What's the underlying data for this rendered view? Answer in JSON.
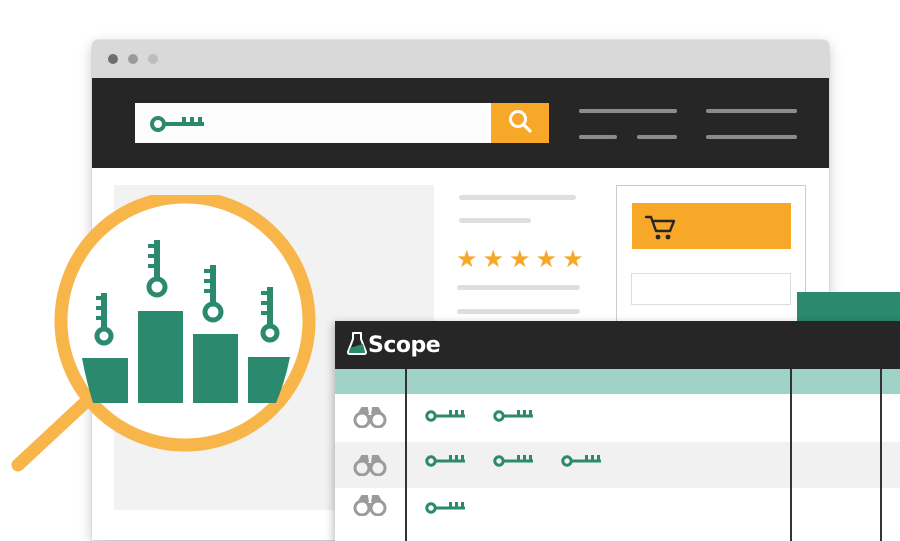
{
  "app": {
    "name": "Scope",
    "logo_icon": "flask-icon"
  },
  "search": {
    "query_icon": "key-icon",
    "button_icon": "search-icon"
  },
  "product": {
    "rating_stars": 5,
    "star_glyph": "★"
  },
  "cart": {
    "button_icon": "cart-icon"
  },
  "scope_table": {
    "rows": [
      {
        "icon": "binoculars-icon",
        "key_count": 2
      },
      {
        "icon": "binoculars-icon",
        "key_count": 3
      },
      {
        "icon": "binoculars-icon",
        "key_count": 1
      }
    ]
  },
  "magnifier": {
    "icon": "magnifier-icon",
    "content": "keyword-ranking-chart"
  },
  "colors": {
    "accent_orange": "#f7a829",
    "brand_green": "#2b8a6e",
    "header_dark": "#262626",
    "table_header_teal": "#9fd3c7"
  }
}
